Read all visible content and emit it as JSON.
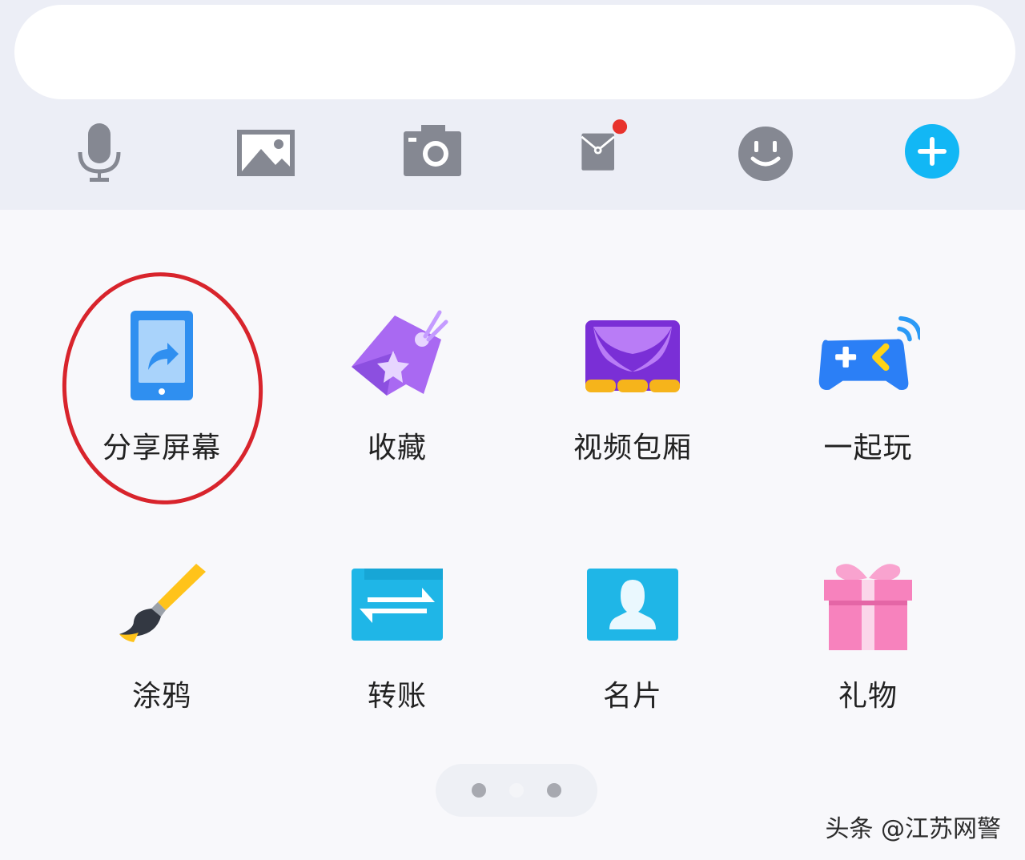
{
  "toolbar": {
    "icons": [
      "microphone-icon",
      "image-icon",
      "camera-icon",
      "red-packet-icon",
      "emoji-icon",
      "plus-icon"
    ],
    "notification_dot_color": "#e8322c",
    "plus_color": "#12b7f5",
    "icon_color": "#858892"
  },
  "panel": {
    "row1": [
      {
        "label": "分享屏幕",
        "icon": "share-screen-icon"
      },
      {
        "label": "收藏",
        "icon": "favorites-icon"
      },
      {
        "label": "视频包厢",
        "icon": "video-box-icon"
      },
      {
        "label": "一起玩",
        "icon": "play-together-icon"
      }
    ],
    "row2": [
      {
        "label": "涂鸦",
        "icon": "doodle-icon"
      },
      {
        "label": "转账",
        "icon": "transfer-icon"
      },
      {
        "label": "名片",
        "icon": "business-card-icon"
      },
      {
        "label": "礼物",
        "icon": "gift-icon"
      }
    ],
    "highlight_color": "#d8242c"
  },
  "pager": {
    "pages": 3,
    "active": 2
  },
  "watermark": "头条 @江苏网警"
}
